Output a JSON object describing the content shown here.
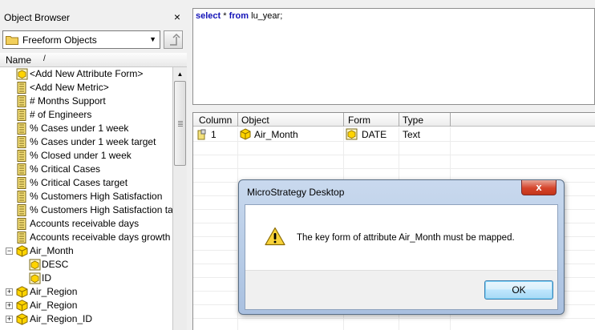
{
  "object_browser": {
    "title": "Object Browser",
    "close": "×",
    "location": "Freeform Objects",
    "column_name": "Name",
    "sort_glyph": "/",
    "items": [
      {
        "label": "<Add New Attribute Form>",
        "icon": "attribute-form-icon"
      },
      {
        "label": "<Add New Metric>",
        "icon": "metric-icon"
      },
      {
        "label": "# Months Support",
        "icon": "metric-icon"
      },
      {
        "label": "# of Engineers",
        "icon": "metric-icon"
      },
      {
        "label": "% Cases under 1 week",
        "icon": "metric-icon"
      },
      {
        "label": "% Cases under 1 week target",
        "icon": "metric-icon"
      },
      {
        "label": "% Closed under 1 week",
        "icon": "metric-icon"
      },
      {
        "label": "% Critical Cases",
        "icon": "metric-icon"
      },
      {
        "label": "% Critical Cases target",
        "icon": "metric-icon"
      },
      {
        "label": "% Customers High Satisfaction",
        "icon": "metric-icon"
      },
      {
        "label": "% Customers High Satisfaction ta",
        "icon": "metric-icon"
      },
      {
        "label": "Accounts receivable days",
        "icon": "metric-icon"
      },
      {
        "label": "Accounts receivable days growth",
        "icon": "metric-icon"
      },
      {
        "label": "Air_Month",
        "icon": "attribute-icon",
        "expander": "−"
      },
      {
        "label": "DESC",
        "icon": "attribute-form-icon",
        "indent": true
      },
      {
        "label": "ID",
        "icon": "attribute-form-icon",
        "indent": true
      },
      {
        "label": "Air_Region",
        "icon": "attribute-icon",
        "expander": "+"
      },
      {
        "label": "Air_Region",
        "icon": "attribute-icon",
        "expander": "+"
      },
      {
        "label": "Air_Region_ID",
        "icon": "attribute-icon",
        "expander": "+"
      }
    ]
  },
  "sql": {
    "select": "select",
    "star": " * ",
    "from": "from",
    "table": " lu_year;"
  },
  "grid": {
    "headers": [
      "Column",
      "Object",
      "Form",
      "Type"
    ],
    "row": {
      "column": "1",
      "object": "Air_Month",
      "form": "DATE",
      "type": "Text"
    }
  },
  "dialog": {
    "title": "MicroStrategy Desktop",
    "close": "x",
    "message": "The key form of attribute Air_Month must be mapped.",
    "ok_label": "OK"
  },
  "colors": {
    "sql_keyword": "#1313b8",
    "metric_icon": "#d4b21f",
    "attribute_icon": "#e8c000"
  }
}
